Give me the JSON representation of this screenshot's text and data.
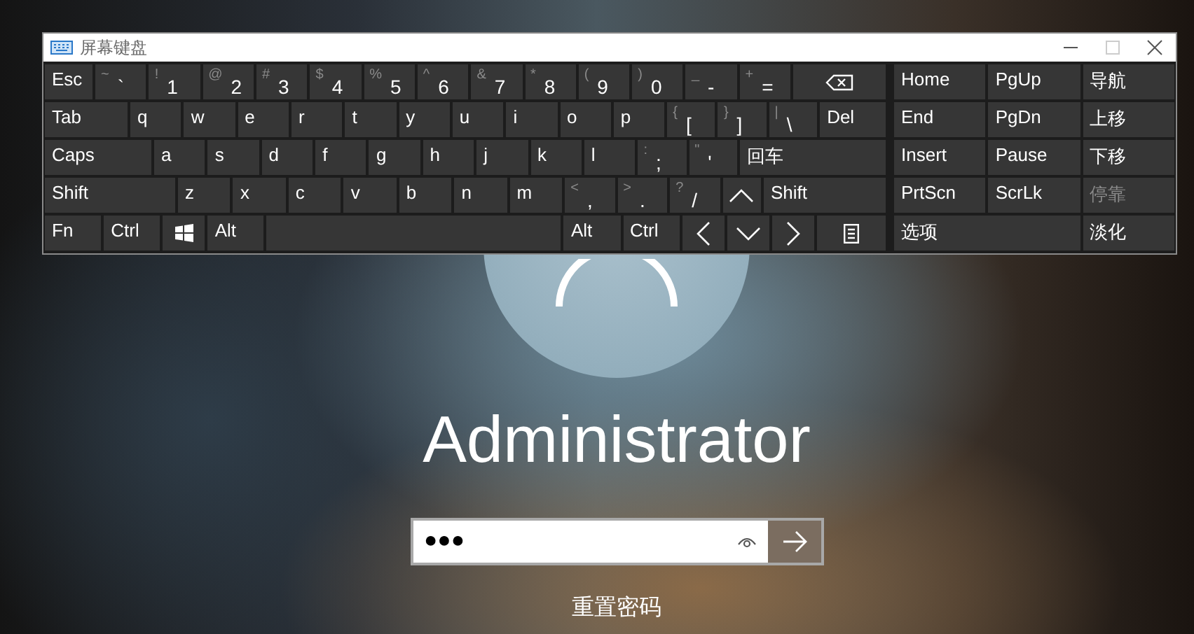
{
  "osk": {
    "title": "屏幕键盘",
    "window_buttons": [
      {
        "kind": "minimize",
        "disabled": false
      },
      {
        "kind": "maximize",
        "disabled": true
      },
      {
        "kind": "close",
        "disabled": false
      }
    ],
    "rows": [
      [
        {
          "kind": "text",
          "label": "Esc"
        },
        {
          "kind": "dual",
          "shift": "~",
          "label": "`"
        },
        {
          "kind": "dual",
          "shift": "!",
          "label": "1"
        },
        {
          "kind": "dual",
          "shift": "@",
          "label": "2"
        },
        {
          "kind": "dual",
          "shift": "#",
          "label": "3"
        },
        {
          "kind": "dual",
          "shift": "$",
          "label": "4"
        },
        {
          "kind": "dual",
          "shift": "%",
          "label": "5"
        },
        {
          "kind": "dual",
          "shift": "^",
          "label": "6"
        },
        {
          "kind": "dual",
          "shift": "&",
          "label": "7"
        },
        {
          "kind": "dual",
          "shift": "*",
          "label": "8"
        },
        {
          "kind": "dual",
          "shift": "(",
          "label": "9"
        },
        {
          "kind": "dual",
          "shift": ")",
          "label": "0"
        },
        {
          "kind": "dual",
          "shift": "_",
          "label": "-"
        },
        {
          "kind": "dual",
          "shift": "+",
          "label": "="
        },
        {
          "kind": "backspace"
        }
      ],
      [
        {
          "kind": "text",
          "label": "Tab"
        },
        {
          "kind": "text",
          "label": "q"
        },
        {
          "kind": "text",
          "label": "w"
        },
        {
          "kind": "text",
          "label": "e"
        },
        {
          "kind": "text",
          "label": "r"
        },
        {
          "kind": "text",
          "label": "t"
        },
        {
          "kind": "text",
          "label": "y"
        },
        {
          "kind": "text",
          "label": "u"
        },
        {
          "kind": "text",
          "label": "i"
        },
        {
          "kind": "text",
          "label": "o"
        },
        {
          "kind": "text",
          "label": "p"
        },
        {
          "kind": "dual",
          "shift": "{",
          "label": "["
        },
        {
          "kind": "dual",
          "shift": "}",
          "label": "]"
        },
        {
          "kind": "dual",
          "shift": "|",
          "label": "\\"
        },
        {
          "kind": "text",
          "label": "Del"
        }
      ],
      [
        {
          "kind": "text",
          "label": "Caps"
        },
        {
          "kind": "text",
          "label": "a"
        },
        {
          "kind": "text",
          "label": "s"
        },
        {
          "kind": "text",
          "label": "d"
        },
        {
          "kind": "text",
          "label": "f"
        },
        {
          "kind": "text",
          "label": "g"
        },
        {
          "kind": "text",
          "label": "h"
        },
        {
          "kind": "text",
          "label": "j"
        },
        {
          "kind": "text",
          "label": "k"
        },
        {
          "kind": "text",
          "label": "l"
        },
        {
          "kind": "dual",
          "shift": ":",
          "label": ";"
        },
        {
          "kind": "dual",
          "shift": "\"",
          "label": "'"
        },
        {
          "kind": "text",
          "label": "回车"
        }
      ],
      [
        {
          "kind": "text",
          "label": "Shift"
        },
        {
          "kind": "text",
          "label": "z"
        },
        {
          "kind": "text",
          "label": "x"
        },
        {
          "kind": "text",
          "label": "c"
        },
        {
          "kind": "text",
          "label": "v"
        },
        {
          "kind": "text",
          "label": "b"
        },
        {
          "kind": "text",
          "label": "n"
        },
        {
          "kind": "text",
          "label": "m"
        },
        {
          "kind": "dual",
          "shift": "<",
          "label": ","
        },
        {
          "kind": "dual",
          "shift": ">",
          "label": "."
        },
        {
          "kind": "dual",
          "shift": "?",
          "label": "/"
        },
        {
          "kind": "up"
        },
        {
          "kind": "text",
          "label": "Shift"
        }
      ],
      [
        {
          "kind": "text",
          "label": "Fn"
        },
        {
          "kind": "text",
          "label": "Ctrl"
        },
        {
          "kind": "windows"
        },
        {
          "kind": "text",
          "label": "Alt"
        },
        {
          "kind": "space"
        },
        {
          "kind": "text",
          "label": "Alt"
        },
        {
          "kind": "text",
          "label": "Ctrl"
        },
        {
          "kind": "left"
        },
        {
          "kind": "down"
        },
        {
          "kind": "right"
        },
        {
          "kind": "menu"
        }
      ]
    ],
    "side_rows": [
      [
        {
          "label": "Home",
          "disabled": false
        },
        {
          "label": "PgUp",
          "disabled": false
        },
        {
          "label": "导航",
          "disabled": false
        }
      ],
      [
        {
          "label": "End",
          "disabled": false
        },
        {
          "label": "PgDn",
          "disabled": false
        },
        {
          "label": "上移",
          "disabled": false
        }
      ],
      [
        {
          "label": "Insert",
          "disabled": false
        },
        {
          "label": "Pause",
          "disabled": false
        },
        {
          "label": "下移",
          "disabled": false
        }
      ],
      [
        {
          "label": "PrtScn",
          "disabled": false
        },
        {
          "label": "ScrLk",
          "disabled": false
        },
        {
          "label": "停靠",
          "disabled": true
        }
      ],
      [
        {
          "label": "选项",
          "disabled": false
        },
        {
          "label": "淡化",
          "disabled": false
        }
      ]
    ]
  },
  "lock": {
    "user": "Administrator",
    "password": {
      "value": "●●●"
    },
    "reset_link": "重置密码"
  }
}
